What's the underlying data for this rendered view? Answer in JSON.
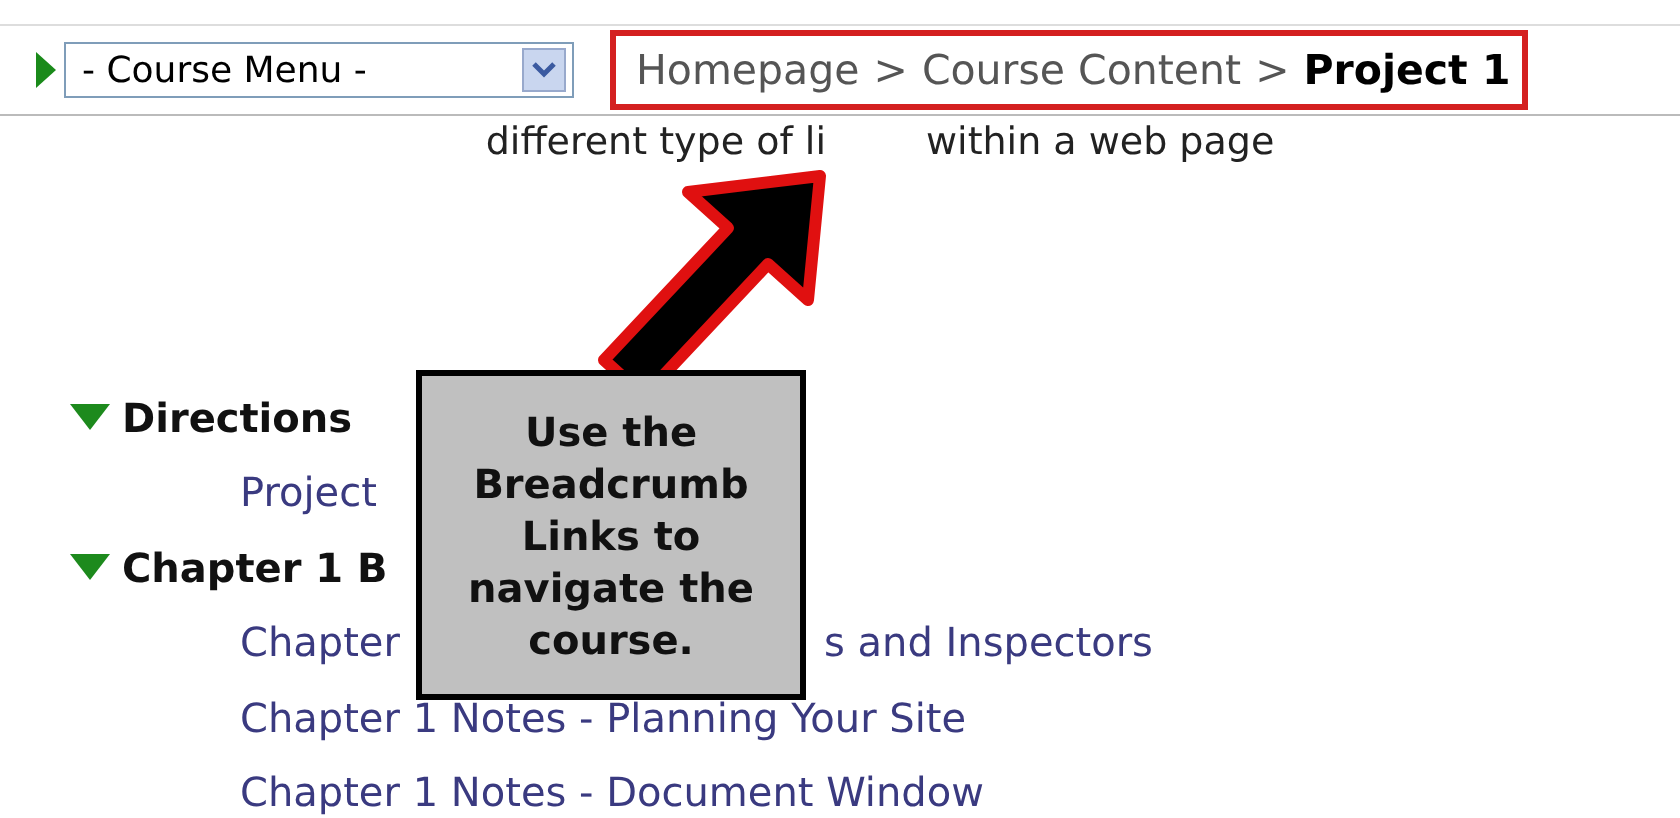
{
  "toolbar": {
    "course_menu": {
      "value": "- Course Menu -"
    }
  },
  "breadcrumb": {
    "separator": ">",
    "items": [
      {
        "label": "Homepage",
        "current": false
      },
      {
        "label": "Course Content",
        "current": false
      },
      {
        "label": "Project 1",
        "current": true
      }
    ]
  },
  "intro_fragments": [
    "different type of li",
    "within a web page"
  ],
  "sections": [
    {
      "title": "Directions",
      "expanded": true,
      "items": [
        {
          "label": "Project"
        }
      ]
    },
    {
      "title": "Chapter 1 B",
      "expanded": true,
      "items": [
        {
          "label": "Chapter",
          "tail": "s and Inspectors"
        },
        {
          "label": "Chapter 1 Notes - Planning Your Site"
        },
        {
          "label": "Chapter 1 Notes - Document Window"
        }
      ]
    }
  ],
  "callout": {
    "lines": [
      "Use the",
      "Breadcrumb",
      "Links to",
      "navigate the",
      "course."
    ]
  }
}
